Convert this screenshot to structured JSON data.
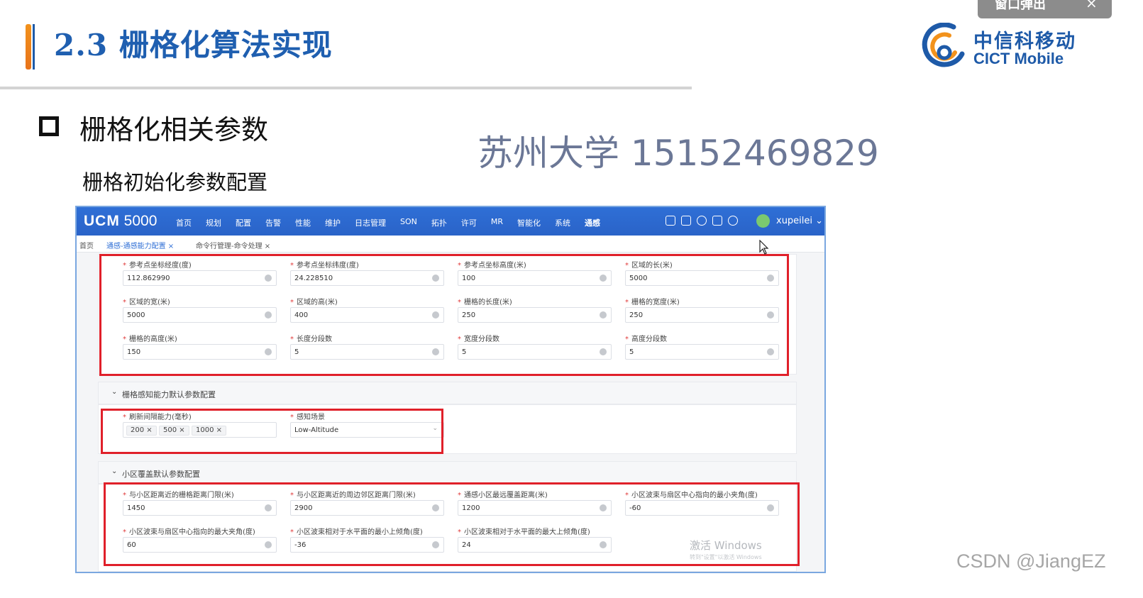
{
  "slide": {
    "title": "2.3 栅格化算法实现",
    "bullet": "栅格化相关参数",
    "sub_heading": "栅格初始化参数配置",
    "watermark": "苏州大学 15152469829",
    "credit": "CSDN @JiangEZ",
    "logo_cn": "中信科移动",
    "logo_en": "CICT Mobile",
    "popup_label": "窗口弹出",
    "popup_close": "×",
    "colors": {
      "accent": "#1f5fb0",
      "highlight": "#e0202a",
      "appbar": "#2f6fd6"
    }
  },
  "app": {
    "brand_bold": "UCM",
    "brand_num": "5000",
    "nav": [
      "首页",
      "规划",
      "配置",
      "告警",
      "性能",
      "维护",
      "日志管理",
      "SON",
      "拓扑",
      "许可",
      "MR",
      "智能化",
      "系统",
      "通感"
    ],
    "icons": [
      "mail-icon",
      "bell-icon",
      "download-icon",
      "image-icon",
      "help-icon"
    ],
    "username": "xupeilei",
    "tabs": {
      "home": "首页",
      "tab1": "通感-通感能力配置 ×",
      "tab2": "命令行管理-命令处理 ×"
    },
    "grid_params": [
      {
        "label": "参考点坐标经度(度)",
        "value": "112.862990"
      },
      {
        "label": "参考点坐标纬度(度)",
        "value": "24.228510"
      },
      {
        "label": "参考点坐标高度(米)",
        "value": "100"
      },
      {
        "label": "区域的长(米)",
        "value": "5000"
      },
      {
        "label": "区域的宽(米)",
        "value": "5000"
      },
      {
        "label": "区域的高(米)",
        "value": "400"
      },
      {
        "label": "栅格的长度(米)",
        "value": "250"
      },
      {
        "label": "栅格的宽度(米)",
        "value": "250"
      },
      {
        "label": "栅格的高度(米)",
        "value": "150"
      },
      {
        "label": "长度分段数",
        "value": "5"
      },
      {
        "label": "宽度分段数",
        "value": "5"
      },
      {
        "label": "高度分段数",
        "value": "5"
      }
    ],
    "sense_section": {
      "title": "栅格感知能力默认参数配置",
      "refresh_label": "刷新间隔能力(毫秒)",
      "refresh_tags": [
        "200 ×",
        "500 ×",
        "1000 ×"
      ],
      "scene_label": "感知场景",
      "scene_value": "Low-Altitude"
    },
    "cell_section": {
      "title": "小区覆盖默认参数配置",
      "fields": [
        {
          "label": "与小区距离近的栅格距离门限(米)",
          "value": "1450"
        },
        {
          "label": "与小区距离近的周边邻区距离门限(米)",
          "value": "2900"
        },
        {
          "label": "通感小区最远覆盖距离(米)",
          "value": "1200"
        },
        {
          "label": "小区波束与扇区中心指向的最小夹角(度)",
          "value": "-60"
        },
        {
          "label": "小区波束与扇区中心指向的最大夹角(度)",
          "value": "60"
        },
        {
          "label": "小区波束相对于水平面的最小上倾角(度)",
          "value": "-36"
        },
        {
          "label": "小区波束相对于水平面的最大上倾角(度)",
          "value": "24"
        }
      ]
    },
    "win_activate": "激活 Windows",
    "win_activate_sub": "转到\"设置\"以激活 Windows"
  }
}
